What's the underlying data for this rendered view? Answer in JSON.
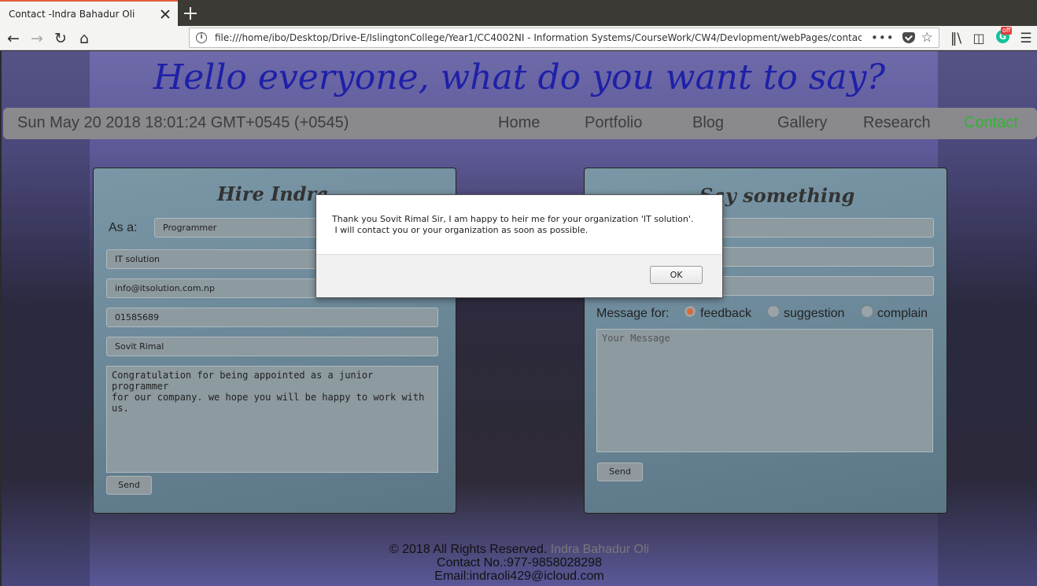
{
  "browser": {
    "tab_title": "Contact -Indra Bahadur Oli",
    "url": "file:///home/ibo/Desktop/Drive-E/IslingtonCollege/Year1/CC4002NI - Information Systems/CourseWork/CW4/Devlopment/webPages/contact.html?employee=programm",
    "extension_badge": "off",
    "extension_letter": "G",
    "url_more": "•••"
  },
  "page": {
    "heading": "Hello everyone, what do you want to say?",
    "clock": "Sun May 20 2018 18:01:24 GMT+0545 (+0545)",
    "nav": [
      "Home",
      "Portfolio",
      "Blog",
      "Gallery",
      "Research",
      "Contact"
    ],
    "nav_active": "Contact"
  },
  "hire_form": {
    "title": "Hire Indra",
    "as_label": "As a:",
    "role": "Programmer",
    "organization": "IT solution",
    "email": "info@itsolution.com.np",
    "phone": "01585689",
    "name": "Sovit Rimal",
    "message": "Congratulation for being appointed as a junior programmer\nfor our company. we hope you will be happy to work with us.",
    "send_label": "Send"
  },
  "say_form": {
    "title": "Say something",
    "message_for_label": "Message for:",
    "options": [
      "feedback",
      "suggestion",
      "complain"
    ],
    "selected": "feedback",
    "message_placeholder": "Your Message",
    "send_label": "Send"
  },
  "footer": {
    "rights": "© 2018 All Rights Reserved.",
    "owner": "Indra Bahadur Oli",
    "contact": "Contact No.:977-9858028298",
    "email": "Email:indraoli429@icloud.com"
  },
  "dialog": {
    "message": "Thank you Sovit Rimal Sir, I am happy to heir me for your organization 'IT solution'.\n I will contact you or your organization as soon as possible.",
    "ok_label": "OK"
  }
}
